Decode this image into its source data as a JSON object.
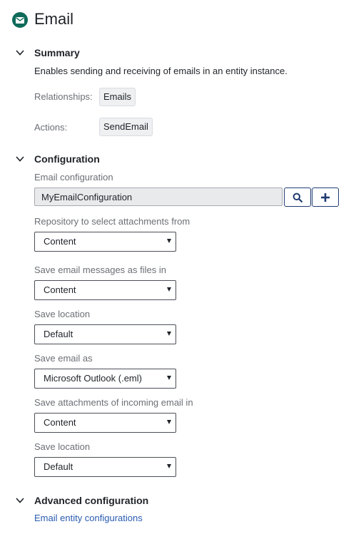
{
  "title": "Email",
  "summary": {
    "heading": "Summary",
    "description": "Enables sending and receiving of emails in an entity instance.",
    "relationships_label": "Relationships:",
    "relationships_value": "Emails",
    "actions_label": "Actions:",
    "actions_value": "SendEmail"
  },
  "configuration": {
    "heading": "Configuration",
    "email_config_label": "Email configuration",
    "email_config_value": "MyEmailConfiguration",
    "fields": [
      {
        "label": "Repository to select attachments from",
        "value": "Content"
      },
      {
        "label": "Save email messages as files in",
        "value": "Content"
      },
      {
        "label": "Save location",
        "value": "Default"
      },
      {
        "label": "Save email as",
        "value": "Microsoft Outlook (.eml)"
      },
      {
        "label": "Save attachments of incoming email in",
        "value": "Content"
      },
      {
        "label": "Save location",
        "value": "Default"
      }
    ]
  },
  "advanced": {
    "heading": "Advanced configuration",
    "link": "Email entity configurations"
  },
  "colors": {
    "accent_teal": "#0f6b5a",
    "button_border": "#1f3b73",
    "link": "#2a5bb0"
  }
}
